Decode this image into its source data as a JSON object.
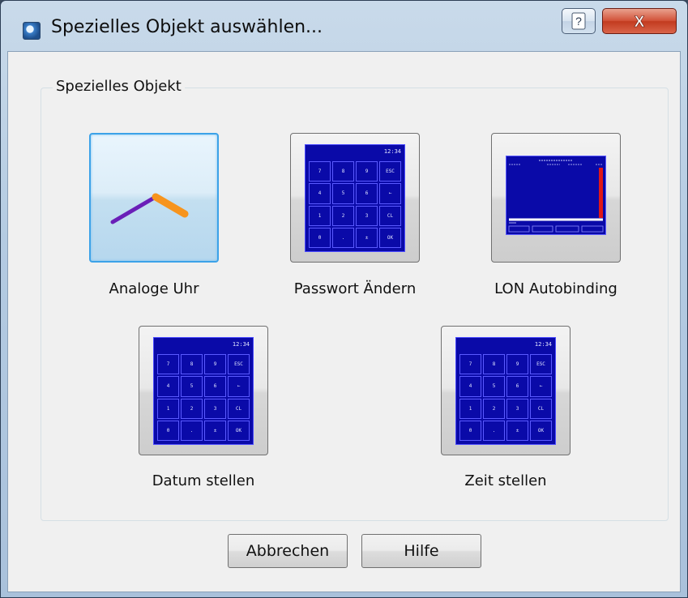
{
  "window": {
    "title": "Spezielles Objekt auswählen...",
    "help_button_label": "?",
    "close_button_label": "X"
  },
  "group": {
    "label": "Spezielles Objekt",
    "items": [
      {
        "label": "Analoge Uhr",
        "selected": true,
        "preview": "analog-clock"
      },
      {
        "label": "Passwort Ändern",
        "selected": false,
        "preview": "keypad"
      },
      {
        "label": "LON Autobinding",
        "selected": false,
        "preview": "lon-screen"
      },
      {
        "label": "Datum stellen",
        "selected": false,
        "preview": "keypad"
      },
      {
        "label": "Zeit stellen",
        "selected": false,
        "preview": "keypad"
      }
    ]
  },
  "buttons": {
    "cancel": "Abbrechen",
    "help": "Hilfe"
  },
  "keypad": {
    "display": "12:34",
    "keys": [
      "7",
      "8",
      "9",
      "ESC",
      "4",
      "5",
      "6",
      "←",
      "1",
      "2",
      "3",
      "CL",
      "0",
      ".",
      "±",
      "OK"
    ]
  },
  "colors": {
    "accent": "#3ca2e8",
    "preview_background": "#0a0aa8",
    "clock_hour_hand": "#f7941d",
    "clock_minute_hand": "#6a1fb8",
    "close_button": "#c23b1f"
  }
}
